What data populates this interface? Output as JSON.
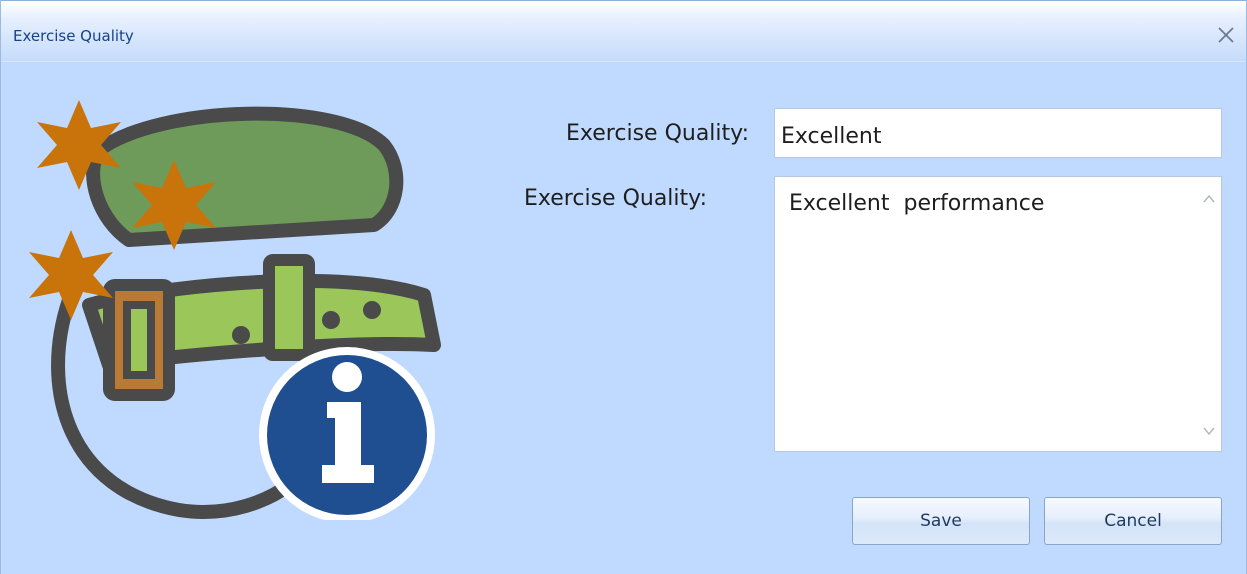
{
  "window": {
    "title": "Exercise Quality",
    "close_icon": "close-icon"
  },
  "form": {
    "quality_label": "Exercise Quality:",
    "quality_value": "Excellent",
    "notes_label": "Exercise Quality:",
    "notes_value": "Excellent  performance"
  },
  "buttons": {
    "save_label": "Save",
    "cancel_label": "Cancel"
  },
  "illustration": {
    "icon": "dog-collar-stars-info-icon"
  },
  "colors": {
    "window_bg": "#c0daff",
    "title_text": "#15428b",
    "star": "#c8740a",
    "collar_dark_green": "#6f9b5a",
    "collar_light_green": "#9bc75a",
    "buckle": "#b87a34",
    "outline": "#4a4a4a",
    "info_circle": "#1f4e91"
  }
}
